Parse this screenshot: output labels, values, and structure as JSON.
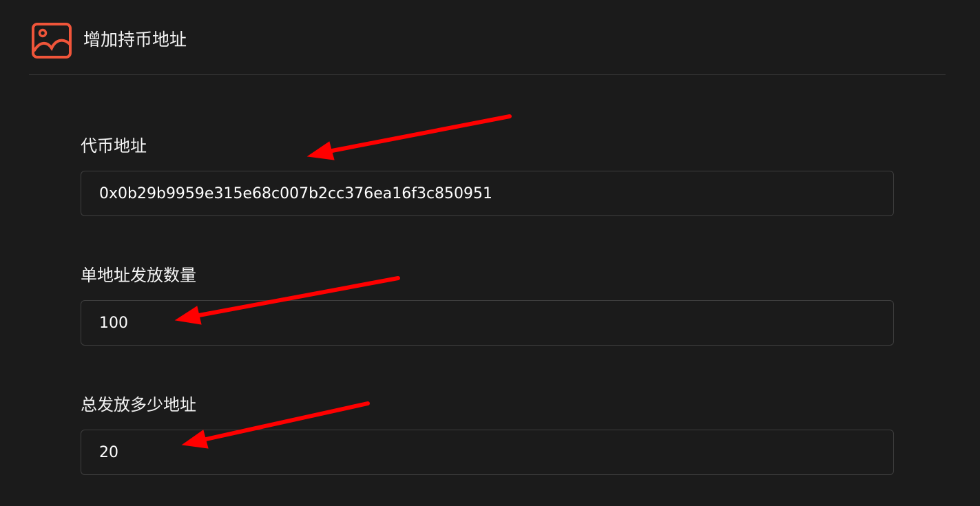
{
  "header": {
    "title": "增加持币地址",
    "icon": "image-icon",
    "icon_color": "#f0553a"
  },
  "form": {
    "fields": [
      {
        "label": "代币地址",
        "value": "0x0b29b9959e315e68c007b2cc376ea16f3c850951"
      },
      {
        "label": "单地址发放数量",
        "value": "100"
      },
      {
        "label": "总发放多少地址",
        "value": "20"
      }
    ]
  },
  "annotations": {
    "arrow_color": "#ff0000"
  }
}
